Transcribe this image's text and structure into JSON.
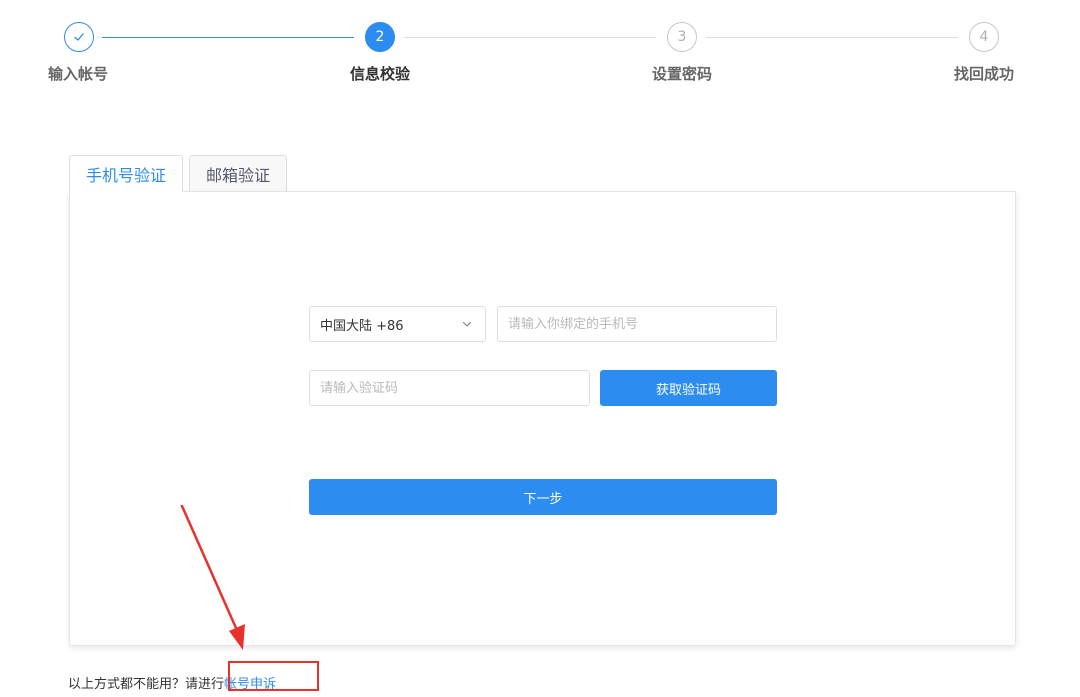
{
  "steps": {
    "items": [
      {
        "number": "✓",
        "label": "输入帐号",
        "status": "done"
      },
      {
        "number": "2",
        "label": "信息校验",
        "status": "active"
      },
      {
        "number": "3",
        "label": "设置密码",
        "status": "wait"
      },
      {
        "number": "4",
        "label": "找回成功",
        "status": "wait"
      }
    ]
  },
  "tabs": [
    {
      "label": "手机号验证",
      "active": true
    },
    {
      "label": "邮箱验证",
      "active": false
    }
  ],
  "form": {
    "country_value": "中国大陆 +86",
    "phone_placeholder": "请输入你绑定的手机号",
    "code_placeholder": "请输入验证码",
    "get_code_label": "获取验证码",
    "next_label": "下一步"
  },
  "help": {
    "text": "以上方式都不能用？请进行",
    "link_label": "帐号申诉"
  },
  "colors": {
    "accent": "#2d8cf0",
    "annotation": "#e9312c"
  },
  "icons": {
    "step_done": "check-icon",
    "select": "chevron-down-icon"
  }
}
